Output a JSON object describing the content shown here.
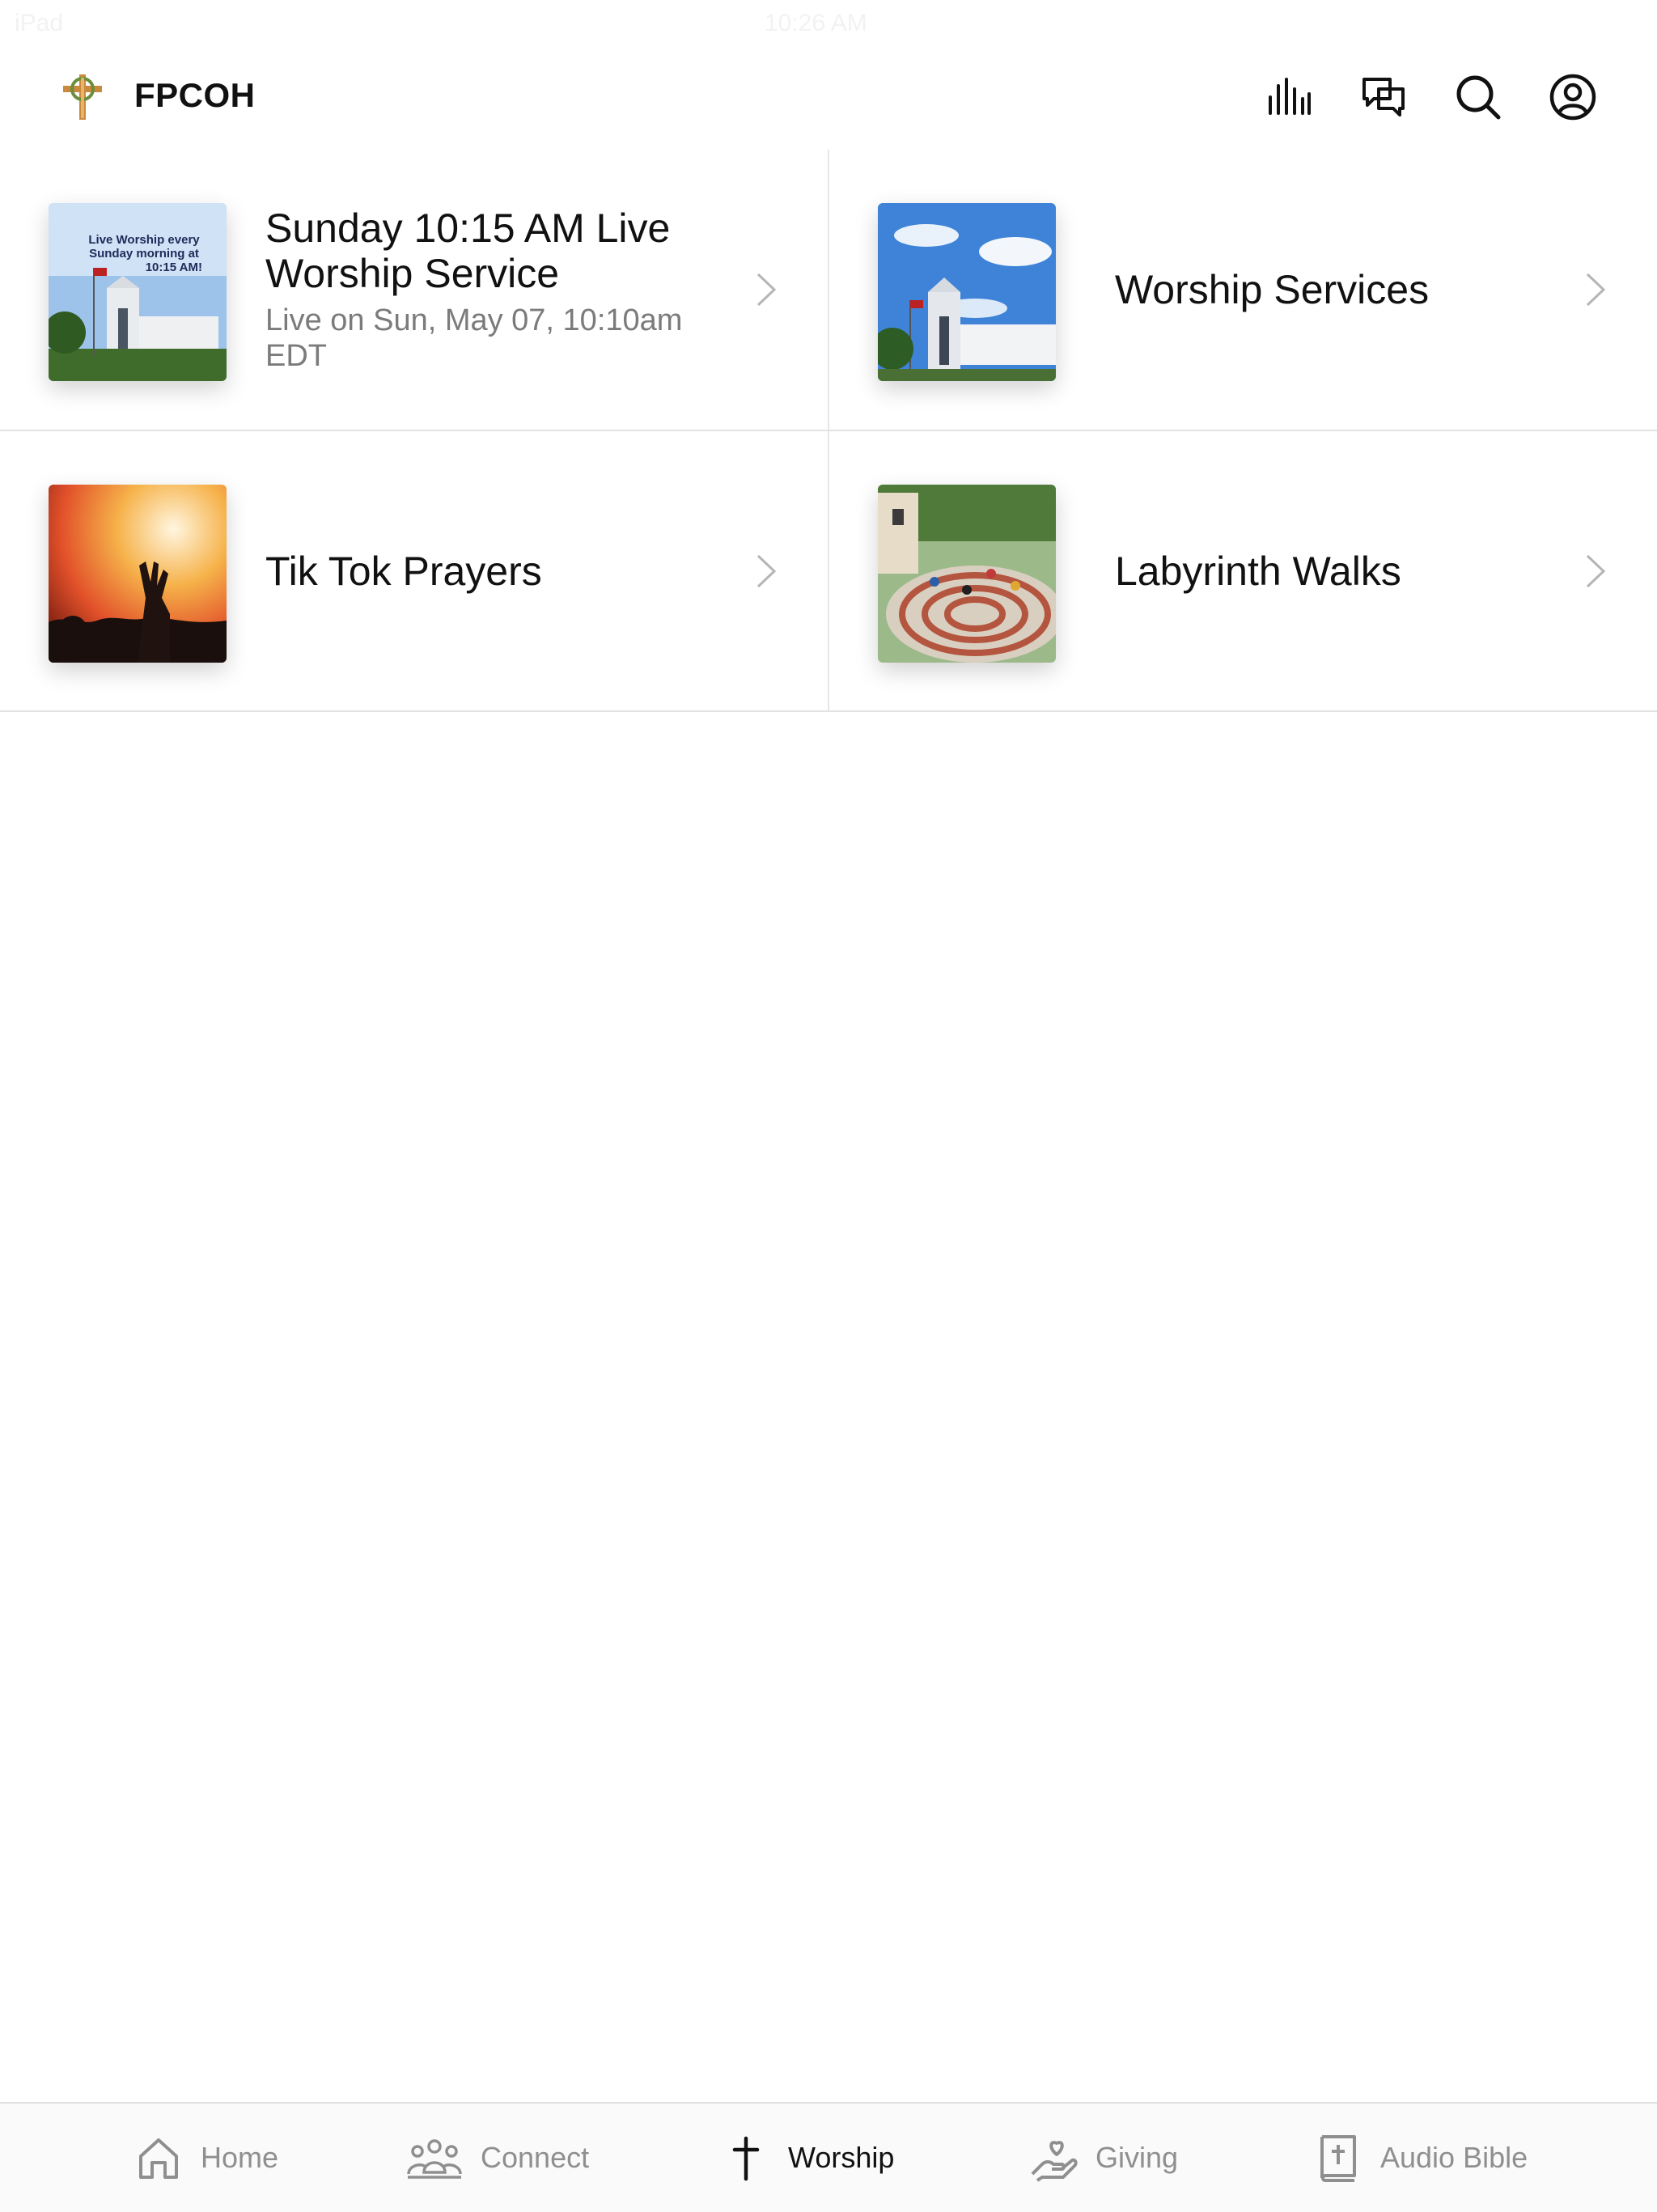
{
  "status_bar": {
    "device": "iPad",
    "time": "10:26 AM"
  },
  "header": {
    "title": "FPCOH",
    "icons": [
      "audio-bars-icon",
      "chat-icon",
      "search-icon",
      "profile-icon"
    ]
  },
  "items": [
    {
      "title": "Sunday 10:15 AM Live Worship Service",
      "subtitle": "Live on Sun, May 07, 10:10am EDT",
      "thumb_text": "Live Worship every Sunday morning at 10:15 AM!"
    },
    {
      "title": "Worship Services",
      "subtitle": ""
    },
    {
      "title": "Tik Tok Prayers",
      "subtitle": ""
    },
    {
      "title": "Labyrinth Walks",
      "subtitle": ""
    }
  ],
  "tabbar": {
    "tabs": [
      {
        "label": "Home",
        "icon": "home-icon"
      },
      {
        "label": "Connect",
        "icon": "people-icon"
      },
      {
        "label": "Worship",
        "icon": "cross-icon",
        "active": true
      },
      {
        "label": "Giving",
        "icon": "hand-heart-icon"
      },
      {
        "label": "Audio Bible",
        "icon": "bible-icon"
      }
    ]
  },
  "colors": {
    "accent": "#111111",
    "inactive": "#8f8f8f",
    "divider": "#e3e3e3"
  }
}
